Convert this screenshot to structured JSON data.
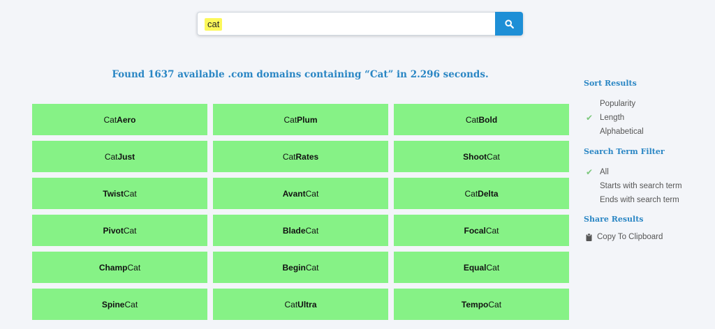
{
  "search": {
    "value": "cat"
  },
  "results": {
    "found_text": "Found 1637 available .com domains containing “Cat” in 2.296 seconds."
  },
  "domains": [
    {
      "pre": "Cat",
      "bold": "Aero",
      "post": ""
    },
    {
      "pre": "Cat",
      "bold": "Plum",
      "post": ""
    },
    {
      "pre": "Cat",
      "bold": "Bold",
      "post": ""
    },
    {
      "pre": "Cat",
      "bold": "Just",
      "post": ""
    },
    {
      "pre": "Cat",
      "bold": "Rates",
      "post": ""
    },
    {
      "pre": "",
      "bold": "Shoot",
      "post": "Cat"
    },
    {
      "pre": "",
      "bold": "Twist",
      "post": "Cat"
    },
    {
      "pre": "",
      "bold": "Avant",
      "post": "Cat"
    },
    {
      "pre": "Cat",
      "bold": "Delta",
      "post": ""
    },
    {
      "pre": "",
      "bold": "Pivot",
      "post": "Cat"
    },
    {
      "pre": "",
      "bold": "Blade",
      "post": "Cat"
    },
    {
      "pre": "",
      "bold": "Focal",
      "post": "Cat"
    },
    {
      "pre": "",
      "bold": "Champ",
      "post": "Cat"
    },
    {
      "pre": "",
      "bold": "Begin",
      "post": "Cat"
    },
    {
      "pre": "",
      "bold": "Equal",
      "post": "Cat"
    },
    {
      "pre": "",
      "bold": "Spine",
      "post": "Cat"
    },
    {
      "pre": "Cat",
      "bold": "Ultra",
      "post": ""
    },
    {
      "pre": "",
      "bold": "Tempo",
      "post": "Cat"
    }
  ],
  "sidebar": {
    "sort_heading": "Sort Results",
    "sort_options": [
      {
        "label": "Popularity",
        "checked": false
      },
      {
        "label": "Length",
        "checked": true
      },
      {
        "label": "Alphabetical",
        "checked": false
      }
    ],
    "filter_heading": "Search Term Filter",
    "filter_options": [
      {
        "label": "All",
        "checked": true
      },
      {
        "label": "Starts with search term",
        "checked": false
      },
      {
        "label": "Ends with search term",
        "checked": false
      }
    ],
    "share_heading": "Share Results",
    "copy_label": "Copy To Clipboard",
    "check_glyph": "✔"
  },
  "icons": {
    "search": "search-icon",
    "clipboard": "clipboard-icon",
    "check": "check-icon"
  },
  "colors": {
    "accent": "#2a86c4",
    "button": "#1e8fd6",
    "card": "#86f286",
    "highlight": "#fcf85a",
    "check": "#7cc87c"
  }
}
